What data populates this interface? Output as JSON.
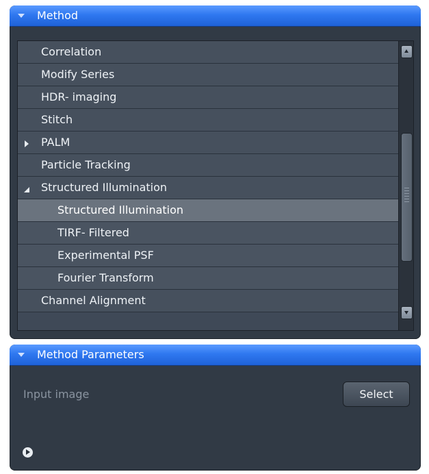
{
  "method_panel": {
    "title": "Method",
    "items": [
      {
        "label": "Correlation",
        "level": 0,
        "expander": "none"
      },
      {
        "label": "Modify Series",
        "level": 0,
        "expander": "none"
      },
      {
        "label": "HDR- imaging",
        "level": 0,
        "expander": "none"
      },
      {
        "label": "Stitch",
        "level": 0,
        "expander": "none"
      },
      {
        "label": "PALM",
        "level": 0,
        "expander": "collapsed"
      },
      {
        "label": "Particle Tracking",
        "level": 0,
        "expander": "none"
      },
      {
        "label": "Structured Illumination",
        "level": 0,
        "expander": "expanded"
      },
      {
        "label": "Structured Illumination",
        "level": 1,
        "expander": "none",
        "selected": true
      },
      {
        "label": "TIRF- Filtered",
        "level": 1,
        "expander": "none"
      },
      {
        "label": "Experimental PSF",
        "level": 1,
        "expander": "none"
      },
      {
        "label": "Fourier Transform",
        "level": 1,
        "expander": "none"
      },
      {
        "label": "Channel Alignment",
        "level": 0,
        "expander": "none"
      }
    ]
  },
  "params_panel": {
    "title": "Method Parameters",
    "input_label": "Input image",
    "select_button": "Select"
  },
  "icons": {
    "panel_collapse": "chevron-down-icon",
    "tree_collapsed": "triangle-right-icon",
    "tree_expanded": "triangle-down-icon",
    "info": "play-circle-icon"
  },
  "colors": {
    "header_blue": "#2f78f0",
    "panel_bg": "#313a45",
    "selected_row": "#6a737e"
  }
}
